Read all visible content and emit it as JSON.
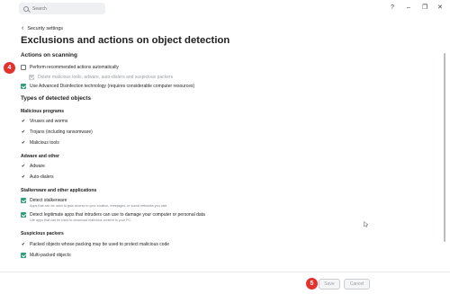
{
  "titlebar": {
    "search_placeholder": "Search",
    "help_glyph": "?",
    "minimize_glyph": "–",
    "restore_glyph": "❐",
    "close_glyph": "✕"
  },
  "breadcrumb": {
    "back_label": "Security settings"
  },
  "page_title": "Exclusions and actions on object detection",
  "actions_on_scanning": {
    "heading": "Actions on scanning",
    "perform_recommended": {
      "label": "Perform recommended actions automatically",
      "checked": false
    },
    "delete_malicious": {
      "label": "Delete malicious tools, adware, auto-dialers and suspicious packers",
      "checked": true,
      "disabled": true
    },
    "advanced_disinfection": {
      "label": "Use Advanced Disinfection technology (requires considerable computer resources)",
      "checked": true
    }
  },
  "types_of_objects": {
    "heading": "Types of detected objects",
    "malicious": {
      "heading": "Malicious programs",
      "items": [
        "Viruses and worms",
        "Trojans (including ransomware)",
        "Malicious tools"
      ]
    },
    "adware": {
      "heading": "Adware and other",
      "items": [
        "Adware",
        "Auto-dialers"
      ]
    },
    "stalkerware": {
      "heading": "Stalkerware and other applications",
      "detect_stalkerware": {
        "label": "Detect stalkerware",
        "description": "Apps that can be used to gain access to your location, messages, or social networks you visit.",
        "checked": true
      },
      "detect_legitimate": {
        "label": "Detect legitimate apps that intruders can use to damage your computer or personal data",
        "description": "Lite apps that can be used to download malicious content to your PC.",
        "checked": true
      }
    },
    "packers": {
      "heading": "Suspicious packers",
      "packed_objects": "Packed objects whose packing may be used to protect malicious code",
      "multi_packed": {
        "label": "Multi-packed objects",
        "checked": true
      }
    }
  },
  "annotations": {
    "badge_4": "4",
    "badge_5": "5"
  },
  "footer": {
    "save_label": "Save",
    "cancel_label": "Cancel"
  },
  "colors": {
    "accent": "#2e9f7a",
    "badge": "#e3322e"
  },
  "icons": [
    "search-icon",
    "back-chevron-icon",
    "check-icon",
    "help-icon",
    "minimize-icon",
    "restore-icon",
    "close-icon",
    "mouse-cursor-icon"
  ]
}
